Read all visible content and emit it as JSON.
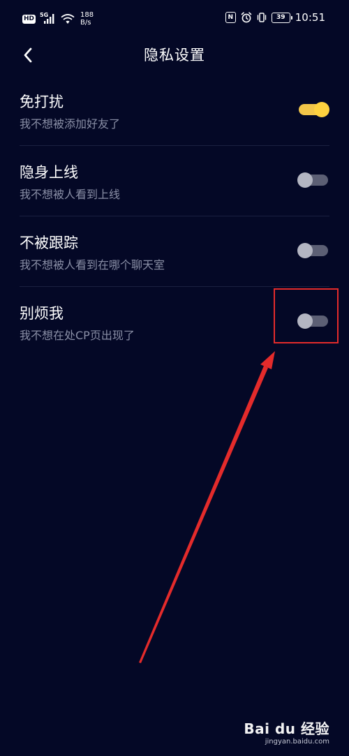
{
  "status_bar": {
    "hd_label": "HD",
    "network_label": "5G",
    "speed_value": "188",
    "speed_unit": "B/s",
    "battery_level": "39",
    "time": "10:51"
  },
  "header": {
    "title": "隐私设置"
  },
  "settings": [
    {
      "title": "免打扰",
      "description": "我不想被添加好友了",
      "enabled": true
    },
    {
      "title": "隐身上线",
      "description": "我不想被人看到上线",
      "enabled": false
    },
    {
      "title": "不被跟踪",
      "description": "我不想被人看到在哪个聊天室",
      "enabled": false
    },
    {
      "title": "别烦我",
      "description": "我不想在处CP页出现了",
      "enabled": false
    }
  ],
  "watermark": {
    "brand": "Bai du 经验",
    "url": "jingyan.baidu.com"
  },
  "colors": {
    "background": "#040826",
    "toggle_on": "#ffd23f",
    "toggle_off": "#5c5f74",
    "annotation": "#e42b2b"
  }
}
